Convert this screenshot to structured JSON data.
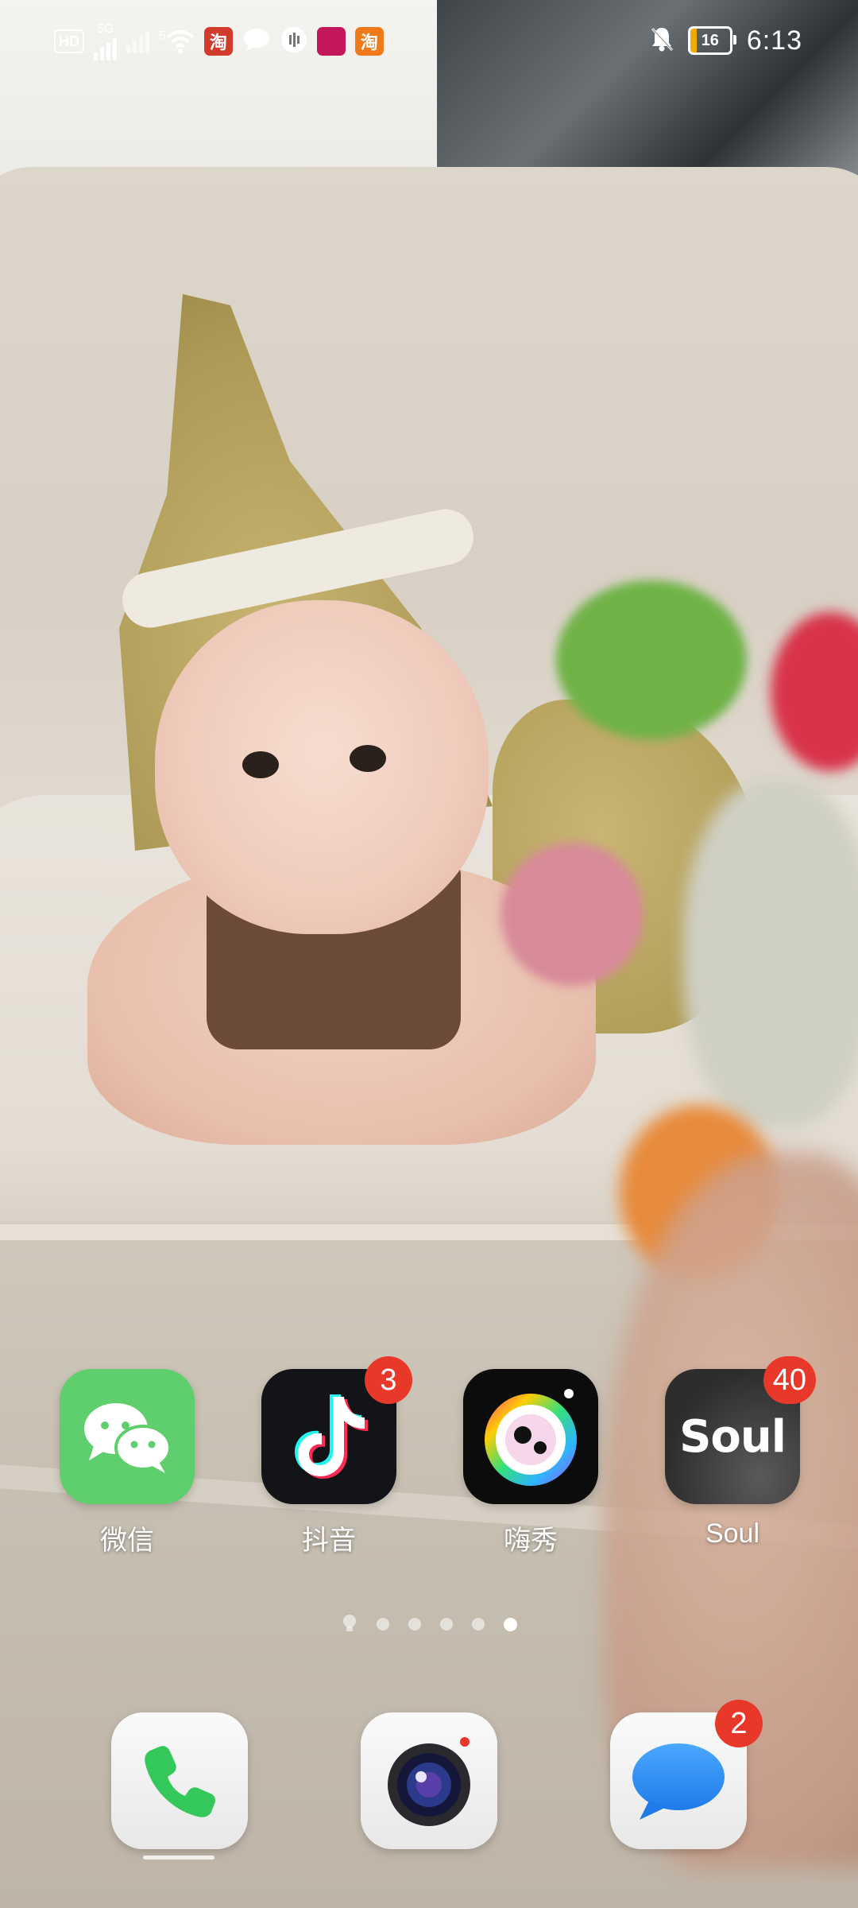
{
  "status_bar": {
    "hd_label": "HD",
    "net_label": "5G",
    "wifi_label": "5",
    "app_taobao_glyph": "淘",
    "battery_level": "16",
    "battery_color": "#f2a900",
    "time": "6:13",
    "icons": [
      "hd-icon",
      "signal-icon",
      "wifi-icon",
      "taobao-icon",
      "chat-icon",
      "recorder-icon",
      "pinduoduo-icon",
      "taobao-icon",
      "mute-bell-icon",
      "battery-icon"
    ]
  },
  "apps": [
    {
      "label": "微信",
      "icon": "wechat-icon",
      "color": "#5fcf6e",
      "badge": ""
    },
    {
      "label": "抖音",
      "icon": "tiktok-icon",
      "color": "#121418",
      "badge": "3"
    },
    {
      "label": "嗨秀",
      "icon": "camera-lens-icon",
      "color": "#0c0c0c",
      "badge": ""
    },
    {
      "label": "Soul",
      "icon": "soul-icon",
      "color": "#3a3a3a",
      "badge": "40",
      "logo_text": "Soul"
    }
  ],
  "page_indicator": {
    "count": 6,
    "active_index": 5,
    "first_is_bulb": true
  },
  "dock": [
    {
      "icon": "phone-icon",
      "color": "#34c759",
      "badge": ""
    },
    {
      "icon": "camera-icon",
      "color": "#1b2a6a",
      "badge": ""
    },
    {
      "icon": "messages-icon",
      "color": "#2e8cf0",
      "badge": "2"
    }
  ],
  "badge_color": "#e8382a"
}
